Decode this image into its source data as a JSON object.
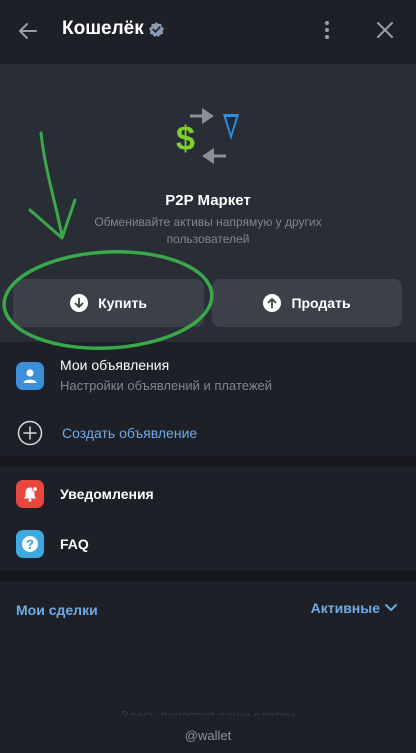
{
  "header": {
    "title": "Кошелёк",
    "back_icon": "arrow-left-icon",
    "verified_icon": "verified-badge-icon",
    "menu_icon": "more-vertical-icon",
    "close_icon": "close-icon"
  },
  "hero": {
    "title": "P2P Маркет",
    "subtitle": "Обменивайте активы напрямую у других пользователей",
    "buy_label": "Купить",
    "sell_label": "Продать"
  },
  "menu": {
    "my_ads_title": "Мои объявления",
    "my_ads_sub": "Настройки объявлений и платежей",
    "create_ad": "Создать объявление",
    "notifications": "Уведомления",
    "faq": "FAQ"
  },
  "deals": {
    "title": "Мои сделки",
    "filter": "Активные",
    "empty": "Здесь появятся ваши сделки"
  },
  "footer": {
    "handle": "@wallet"
  },
  "colors": {
    "background": "#1d2026",
    "card": "#292d35",
    "button": "#3c4149",
    "accent_blue": "#6fa9e6",
    "notif_red": "#e8473e",
    "annotation_green": "#3aa84a"
  }
}
